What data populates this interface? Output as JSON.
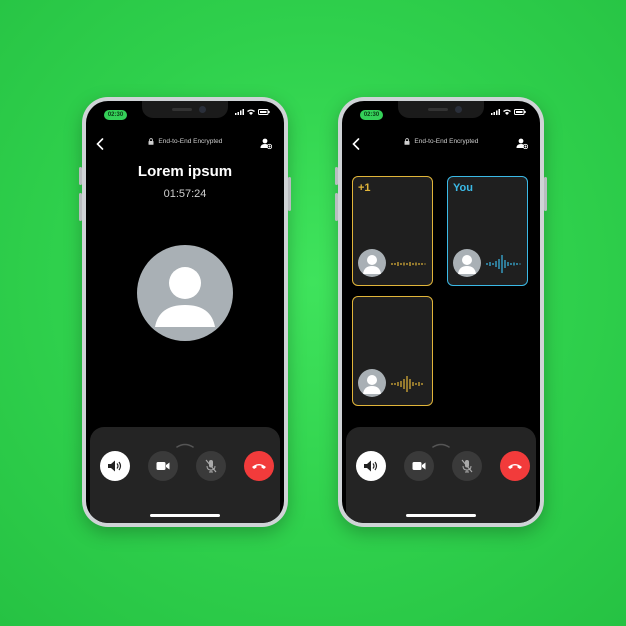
{
  "colors": {
    "background": "#2fd04c",
    "end_call": "#f23b3b",
    "status_pill": "#34d058",
    "tile_yellow": "#e1b53a",
    "tile_blue": "#3bb9e6"
  },
  "phone_left": {
    "status_time": "02:30",
    "header": {
      "back_icon": "chevron-left-icon",
      "encryption_label": "End-to-End Encrypted",
      "add_user_icon": "add-user-icon"
    },
    "caller_name": "Lorem ipsum",
    "call_duration": "01:57:24",
    "avatar_icon": "user-avatar-icon",
    "controls": [
      {
        "name": "speaker",
        "icon": "speaker-icon"
      },
      {
        "name": "video",
        "icon": "video-camera-icon"
      },
      {
        "name": "mute",
        "icon": "mic-off-icon"
      },
      {
        "name": "end-call",
        "icon": "phone-hangup-icon"
      }
    ]
  },
  "phone_right": {
    "status_time": "02:30",
    "header": {
      "back_icon": "chevron-left-icon",
      "encryption_label": "End-to-End Encrypted",
      "add_user_icon": "add-user-icon"
    },
    "tiles": [
      {
        "label": "+1",
        "label_color": "#e1b53a"
      },
      {
        "label": "You",
        "label_color": "#3bb9e6"
      },
      {
        "label": "",
        "label_color": "#e1b53a"
      }
    ],
    "controls": [
      {
        "name": "speaker",
        "icon": "speaker-icon"
      },
      {
        "name": "video",
        "icon": "video-camera-icon"
      },
      {
        "name": "mute",
        "icon": "mic-off-icon"
      },
      {
        "name": "end-call",
        "icon": "phone-hangup-icon"
      }
    ]
  }
}
